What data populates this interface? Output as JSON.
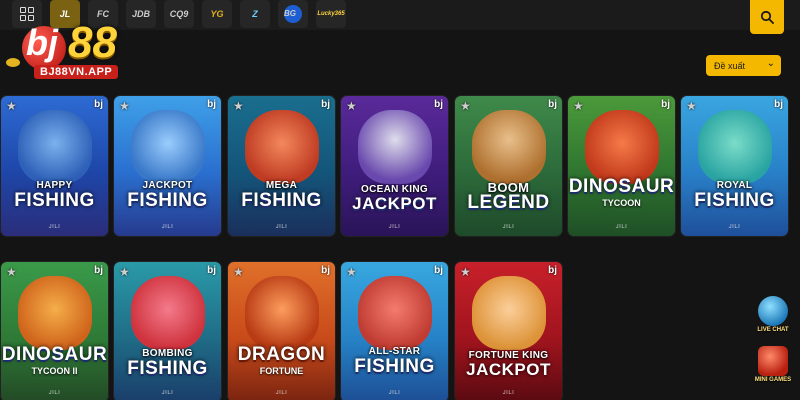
{
  "logo": {
    "brand": "bj",
    "number": "88",
    "url": "BJ88VN.APP"
  },
  "providers": [
    {
      "label": "",
      "icon": "grid-icon",
      "active": false
    },
    {
      "label": "JL",
      "active": true
    },
    {
      "label": "FC",
      "active": false
    },
    {
      "label": "JDB",
      "active": false
    },
    {
      "label": "CQ9",
      "active": false
    },
    {
      "label": "YG",
      "active": false
    },
    {
      "label": "Z",
      "active": false
    },
    {
      "label": "BG",
      "active": false
    },
    {
      "label": "Lucky365",
      "active": false
    }
  ],
  "search": {
    "icon": "search-icon"
  },
  "sort": {
    "label": "Đề xuất",
    "icon": "chevron-down-icon"
  },
  "games": [
    {
      "top": "HAPPY",
      "main": "FISHING",
      "sub": "",
      "provider": "JILI"
    },
    {
      "top": "JACKPOT",
      "main": "FISHING",
      "sub": "",
      "provider": "JILI"
    },
    {
      "top": "MEGA",
      "main": "FISHING",
      "sub": "",
      "provider": "JILI"
    },
    {
      "top": "OCEAN KING",
      "main": "JACKPOT",
      "sub": "",
      "provider": "JILI"
    },
    {
      "top": "BOOM",
      "main": "LEGEND",
      "sub": "",
      "provider": "JILI"
    },
    {
      "top": "",
      "main": "DINOSAUR",
      "sub": "TYCOON",
      "provider": "JILI"
    },
    {
      "top": "ROYAL",
      "main": "FISHING",
      "sub": "",
      "provider": "JILI"
    },
    {
      "top": "",
      "main": "DINOSAUR",
      "sub": "TYCOON II",
      "provider": "JILI"
    },
    {
      "top": "BOMBING",
      "main": "FISHING",
      "sub": "",
      "provider": "JILI"
    },
    {
      "top": "",
      "main": "DRAGON",
      "sub": "FORTUNE",
      "provider": "JILI"
    },
    {
      "top": "ALL-STAR",
      "main": "FISHING",
      "sub": "",
      "provider": "JILI"
    },
    {
      "top": "FORTUNE KING",
      "main": "JACKPOT",
      "sub": "",
      "provider": "JILI"
    }
  ],
  "card_icons": {
    "favorite": "star-icon",
    "badge": "bj"
  },
  "widgets": [
    {
      "label": "LIVE CHAT",
      "icon": "chat-icon"
    },
    {
      "label": "MINI GAMES",
      "icon": "dice-icon"
    }
  ]
}
